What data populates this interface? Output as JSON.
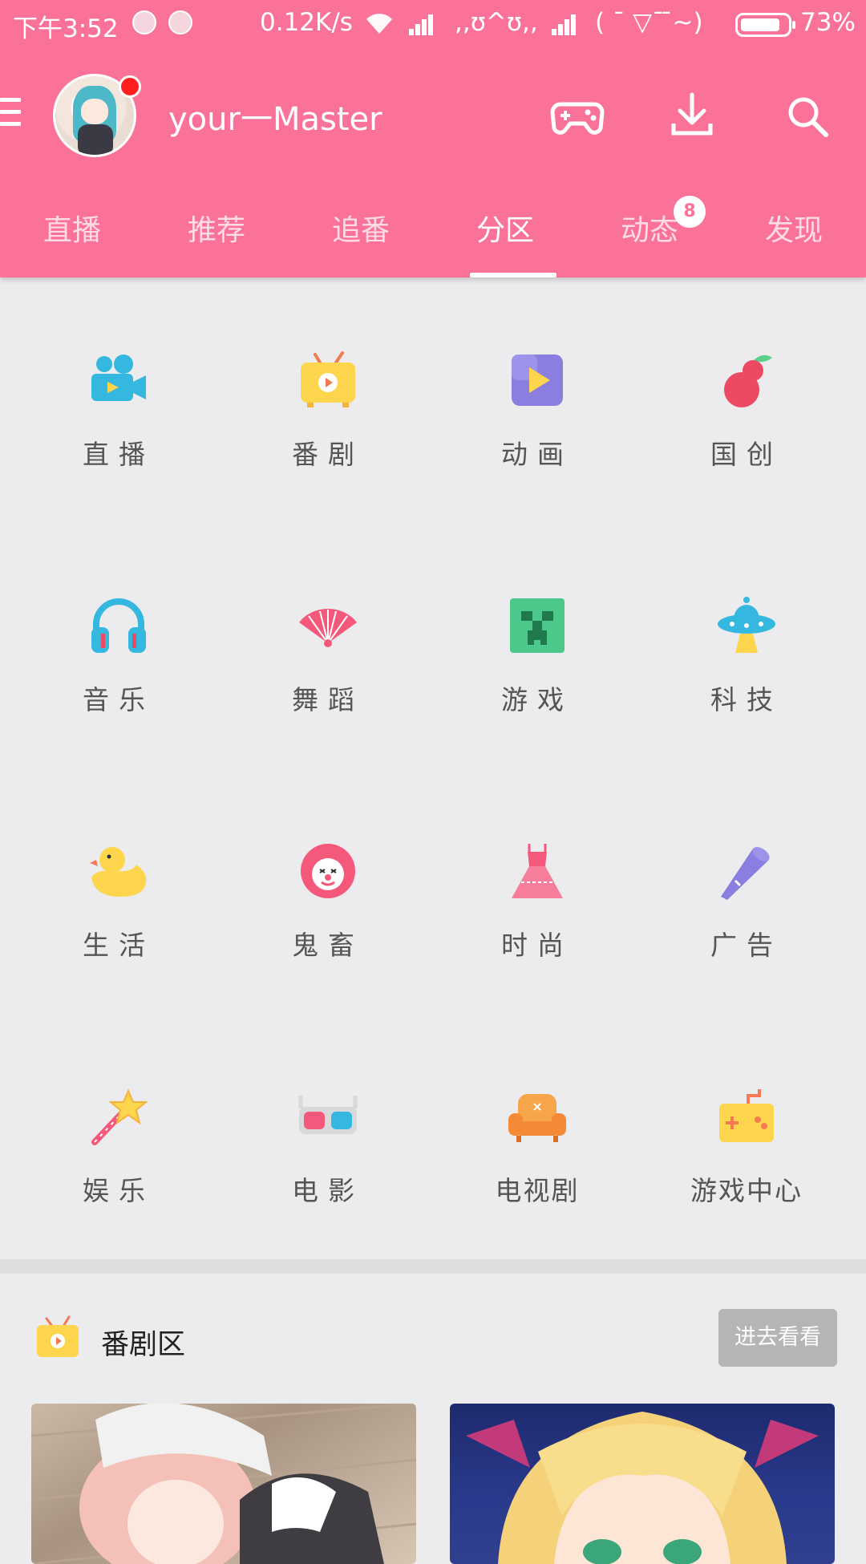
{
  "status_bar": {
    "time": "下午3:52",
    "speed": "0.12K/s",
    "kaomoji1": ",,ʊ^ʊ,,",
    "kaomoji2": "( ˉ ▽ˉ ̄~)",
    "battery": "73%"
  },
  "toolbar": {
    "username": "your一Master",
    "icons": [
      "menu-icon",
      "gamepad-icon",
      "download-icon",
      "search-icon"
    ]
  },
  "tabs": [
    {
      "label": "直播"
    },
    {
      "label": "推荐"
    },
    {
      "label": "追番"
    },
    {
      "label": "分区",
      "active": true
    },
    {
      "label": "动态",
      "badge": "8"
    },
    {
      "label": "发现"
    }
  ],
  "categories": [
    {
      "label": "直播"
    },
    {
      "label": "番剧"
    },
    {
      "label": "动画"
    },
    {
      "label": "国创"
    },
    {
      "label": "音乐"
    },
    {
      "label": "舞蹈"
    },
    {
      "label": "游戏"
    },
    {
      "label": "科技"
    },
    {
      "label": "生活"
    },
    {
      "label": "鬼畜"
    },
    {
      "label": "时尚"
    },
    {
      "label": "广告"
    },
    {
      "label": "娱乐"
    },
    {
      "label": "电影"
    },
    {
      "label": "电视剧"
    },
    {
      "label": "游戏中心"
    }
  ],
  "section": {
    "title": "番剧区",
    "more_button": "进去看看"
  },
  "colors": {
    "brand_pink": "#fb7299",
    "background": "#ececee"
  }
}
